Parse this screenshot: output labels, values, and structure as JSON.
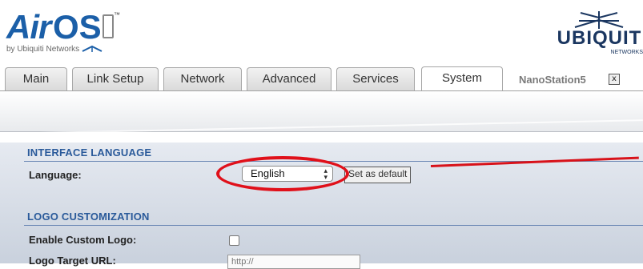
{
  "header": {
    "logo_air": "Air",
    "logo_os": "OS",
    "logo_tm": "™",
    "by_line": "by Ubiquiti Networks",
    "brand_name": "UBIQUITI",
    "brand_sub": "NETWORKS"
  },
  "tabs": [
    {
      "label": "Main",
      "active": false
    },
    {
      "label": "Link Setup",
      "active": false
    },
    {
      "label": "Network",
      "active": false
    },
    {
      "label": "Advanced",
      "active": false
    },
    {
      "label": "Services",
      "active": false
    },
    {
      "label": "System",
      "active": true
    }
  ],
  "device_name": "NanoStation5",
  "close_glyph": "x",
  "interface_language": {
    "title": "INTERFACE LANGUAGE",
    "language_label": "Language:",
    "language_value": "English",
    "set_default_label": "Set as default"
  },
  "logo_customization": {
    "title": "LOGO CUSTOMIZATION",
    "enable_label": "Enable Custom Logo:",
    "enable_checked": false,
    "target_url_label": "Logo Target URL:",
    "target_url_placeholder": "http://"
  },
  "colors": {
    "accent": "#2a5a9a",
    "annotation_red": "#e0101a"
  }
}
